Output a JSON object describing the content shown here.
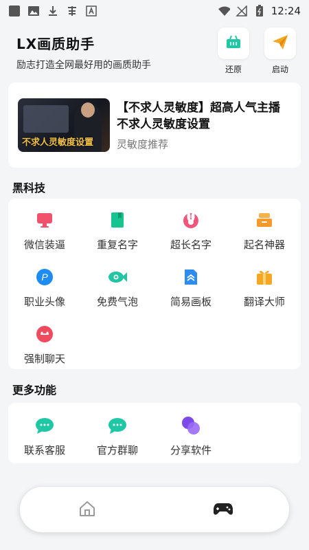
{
  "status_bar": {
    "time": "12:24"
  },
  "header": {
    "title": "LX画质助手",
    "subtitle": "励志打造全网最好用的画质助手",
    "restore_label": "还原",
    "launch_label": "启动"
  },
  "featured": {
    "title": "【不求人灵敏度】超高人气主播不求人灵敏度设置",
    "subtitle": "灵敏度推荐",
    "thumb_caption": "不求人灵敏度设置"
  },
  "sections": {
    "black_tech": "黑科技",
    "more_features": "更多功能"
  },
  "black_tech_items": [
    {
      "label": "微信装逼",
      "icon": "monitor-icon",
      "color": "#f0516b"
    },
    {
      "label": "重复名字",
      "icon": "book-icon",
      "color": "#17c38f"
    },
    {
      "label": "超长名字",
      "icon": "rabbit-icon",
      "color": "#f2557a"
    },
    {
      "label": "起名神器",
      "icon": "stack-icon",
      "color": "#f79a2c"
    },
    {
      "label": "职业头像",
      "icon": "p-icon",
      "color": "#1e8cf0"
    },
    {
      "label": "免费气泡",
      "icon": "fish-icon",
      "color": "#22c5a3"
    },
    {
      "label": "简易画板",
      "icon": "document-icon",
      "color": "#2d8cf0"
    },
    {
      "label": "翻译大师",
      "icon": "gift-icon",
      "color": "#f5a623"
    },
    {
      "label": "强制聊天",
      "icon": "chat-face-icon",
      "color": "#f04a5e"
    }
  ],
  "more_items": [
    {
      "label": "联系客服",
      "icon": "chat-bubble-icon",
      "color": "#1fc7a5"
    },
    {
      "label": "官方群聊",
      "icon": "group-chat-icon",
      "color": "#1fc7a5"
    },
    {
      "label": "分享软件",
      "icon": "share-circles-icon",
      "color": "#7b4ae8"
    }
  ],
  "colors": {
    "accent": "#1fc7a5",
    "background": "#f4f5f7"
  }
}
